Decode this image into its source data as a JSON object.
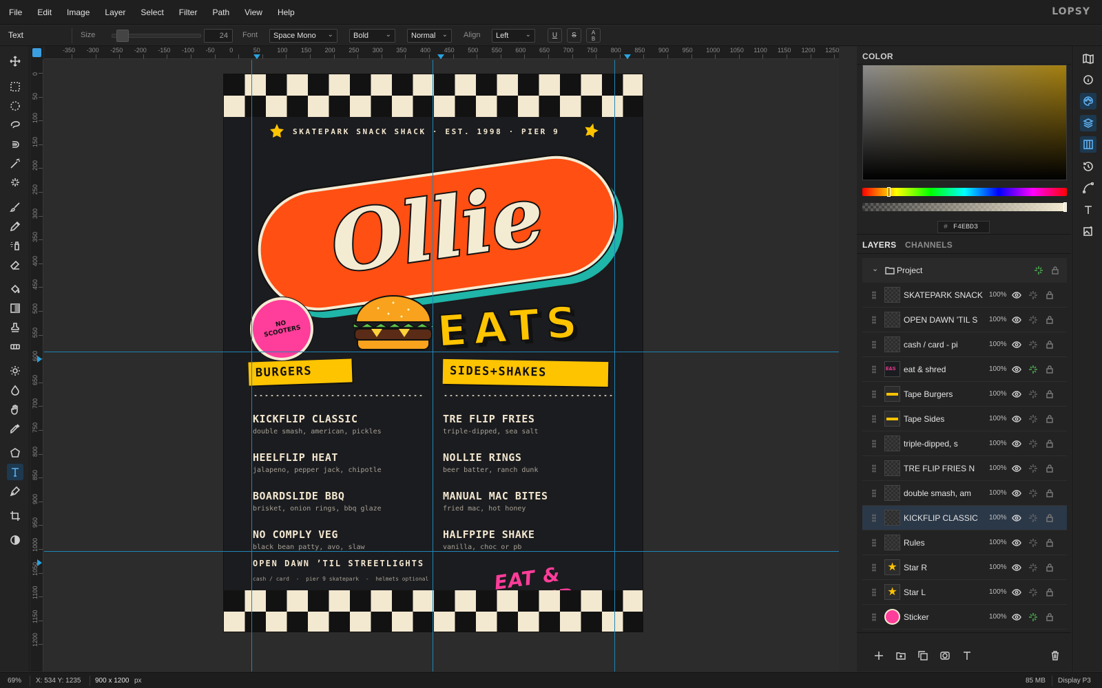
{
  "app": {
    "logo": "LOPSY"
  },
  "menu": [
    "File",
    "Edit",
    "Image",
    "Layer",
    "Select",
    "Filter",
    "Path",
    "View",
    "Help"
  ],
  "options": {
    "tool_name": "Text",
    "size_label": "Size",
    "size_value": "24",
    "font_label": "Font",
    "font_value": "Space Mono",
    "weight_value": "Bold",
    "style_value": "Normal",
    "align_label": "Align",
    "align_value": "Left",
    "underline": "U",
    "strike": "S",
    "case_top": "A",
    "case_bottom": "B"
  },
  "ruler_top": [
    "-350",
    "-300",
    "-250",
    "-200",
    "-150",
    "-100",
    "-50",
    "0",
    "50",
    "100",
    "150",
    "200",
    "250",
    "300",
    "350",
    "400",
    "450",
    "500",
    "550",
    "600",
    "650",
    "700",
    "750",
    "800",
    "850",
    "900",
    "950",
    "1000",
    "1050",
    "1100",
    "1150",
    "1200",
    "1250",
    "13"
  ],
  "ruler_left": [
    "0",
    "50",
    "100",
    "150",
    "200",
    "250",
    "300",
    "350",
    "400",
    "450",
    "500",
    "550",
    "600",
    "650",
    "700",
    "750",
    "800",
    "850",
    "900",
    "950",
    "1000",
    "1050",
    "1100",
    "1150",
    "1200"
  ],
  "poster": {
    "tagline": "SKATEPARK SNACK SHACK · EST. 1998 · PIER 9",
    "brand": "Ollie",
    "eats": "EATS",
    "sticker_line1": "NO",
    "sticker_line2": "SCOOTERS",
    "col_left_title": "BURGERS",
    "col_right_title": "SIDES+SHAKES",
    "left_items": [
      {
        "name": "KICKFLIP CLASSIC",
        "desc": "double smash, american, pickles"
      },
      {
        "name": "HEELFLIP HEAT",
        "desc": "jalapeno, pepper jack, chipotle"
      },
      {
        "name": "BOARDSLIDE BBQ",
        "desc": "brisket, onion rings, bbq glaze"
      },
      {
        "name": "NO COMPLY VEG",
        "desc": "black bean patty, avo, slaw"
      }
    ],
    "right_items": [
      {
        "name": "TRE FLIP FRIES",
        "desc": "triple-dipped, sea salt"
      },
      {
        "name": "NOLLIE RINGS",
        "desc": "beer batter, ranch dunk"
      },
      {
        "name": "MANUAL MAC BITES",
        "desc": "fried mac, hot honey"
      },
      {
        "name": "HALFPIPE SHAKE",
        "desc": "vanilla, choc or pb"
      }
    ],
    "hours": "OPEN DAWN ’TIL STREETLIGHTS",
    "footer_info": "cash / card  -  pier 9 skatepark  -  helmets optional",
    "slogan": "EAT & SHRED"
  },
  "color_panel": {
    "title": "COLOR",
    "hex_prefix": "#",
    "hex": "F4EBD3"
  },
  "layers_panel": {
    "tab_layers": "LAYERS",
    "tab_channels": "CHANNELS",
    "group": "Project",
    "layers": [
      {
        "name": "SKATEPARK SNACK",
        "opacity": "100%"
      },
      {
        "name": "OPEN DAWN 'TIL S",
        "opacity": "100%"
      },
      {
        "name": "cash / card - pi",
        "opacity": "100%"
      },
      {
        "name": "eat & shred",
        "opacity": "100%"
      },
      {
        "name": "Tape Burgers",
        "opacity": "100%"
      },
      {
        "name": "Tape Sides",
        "opacity": "100%"
      },
      {
        "name": "triple-dipped, s",
        "opacity": "100%"
      },
      {
        "name": "TRE FLIP FRIES N",
        "opacity": "100%"
      },
      {
        "name": "double smash, am",
        "opacity": "100%"
      },
      {
        "name": "KICKFLIP CLASSIC",
        "opacity": "100%"
      },
      {
        "name": "Rules",
        "opacity": "100%"
      },
      {
        "name": "Star R",
        "opacity": "100%"
      },
      {
        "name": "Star L",
        "opacity": "100%"
      },
      {
        "name": "Sticker",
        "opacity": "100%"
      }
    ]
  },
  "status": {
    "zoom": "69%",
    "coords": "X: 534 Y: 1235",
    "dims": "900 x 1200",
    "dims_unit": "px",
    "memory": "85 MB",
    "profile": "Display P3"
  },
  "colors": {
    "accent": "#3b9ee0",
    "orange": "#ff4f12",
    "teal": "#1fb5a8",
    "yellow": "#ffc400",
    "cream": "#f4ebd3",
    "pink": "#ff3d9a"
  }
}
